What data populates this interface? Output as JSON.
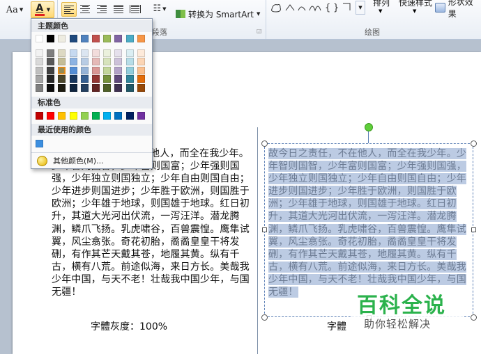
{
  "ribbon": {
    "font_size_label": "Aa",
    "font_color_letter": "A",
    "font_color_accent": "#e01f1f",
    "smartart_label": "转换为 SmartArt",
    "paragraph_group_label": "段落",
    "drawing_group_label": "绘图",
    "arrange_label": "排列",
    "quick_styles_label": "快速样式",
    "shape_effects_label": "形状效果"
  },
  "color_popup": {
    "theme_header": "主题颜色",
    "theme_columns": [
      [
        "#ffffff",
        "#f2f2f2",
        "#d9d9d9",
        "#bfbfbf",
        "#a6a6a6",
        "#7f7f7f"
      ],
      [
        "#000000",
        "#7f7f7f",
        "#595959",
        "#404040",
        "#262626",
        "#0d0d0d"
      ],
      [
        "#eeece1",
        "#ddd9c3",
        "#c4bd97",
        "#948a54",
        "#4a452a",
        "#1d1b10"
      ],
      [
        "#1f497d",
        "#c6d9f0",
        "#8db3e2",
        "#548dd4",
        "#17365d",
        "#0f243e"
      ],
      [
        "#4f81bd",
        "#dbe5f1",
        "#b8cce4",
        "#95b3d7",
        "#366092",
        "#244061"
      ],
      [
        "#c0504d",
        "#f2dcdb",
        "#e5b9b7",
        "#d99694",
        "#953734",
        "#632423"
      ],
      [
        "#9bbb59",
        "#ebf1dd",
        "#d7e3bc",
        "#c3d69b",
        "#76923c",
        "#4f6128"
      ],
      [
        "#8064a2",
        "#e5e0ec",
        "#ccc1d9",
        "#b2a2c7",
        "#5f497a",
        "#3f3151"
      ],
      [
        "#4bacc6",
        "#dbeef3",
        "#b7dde8",
        "#92cddc",
        "#31859b",
        "#205867"
      ],
      [
        "#f79646",
        "#fdeada",
        "#fbd5b5",
        "#fac08f",
        "#e36c09",
        "#974806"
      ]
    ],
    "standard_header": "标准色",
    "standard_colors": [
      "#c00000",
      "#ff0000",
      "#ffc000",
      "#ffff00",
      "#92d050",
      "#00b050",
      "#00b0f0",
      "#0070c0",
      "#002060",
      "#7030a0"
    ],
    "recent_header": "最近使用的颜色",
    "recent_colors": [
      "#3c8fe0"
    ],
    "more_colors_label": "其他颜色(M)..."
  },
  "document": {
    "body_text": "故今日之责任，不在他人，而全在我少年。少年智则国智，少年富则国富；少年强则国强，少年独立则国独立；少年自由则国自由；少年进步则国进步；少年胜于欧洲，则国胜于欧洲；少年雄于地球，则国雄于地球。红日初升，其道大光河出伏流，一泻汪洋。潜龙腾渊，鳞爪飞扬。乳虎啸谷，百兽震惶。鹰隼试翼，风尘翕张。奇花初胎，矞矞皇皇干将发硎，有作其芒天戴其苍，地履其黄。纵有千古，横有八荒。前途似海，来日方长。美哉我少年中国，与天不老！壮哉我中国少年，与国无疆！",
    "left_text_visible": "他人，而全在我少年。少年智则国智，少年富则国富；少年强则国强，少年独立则国独立；少年自由则国自由；少年进步则国进步；少年胜于欧洲，则国胜于欧洲；少年雄于地球，则国雄于地球。红日初升，其道大光河出伏流，一泻汪洋。潜龙腾渊，鳞爪飞扬。乳虎啸谷，百兽震惶。鹰隼试翼，风尘翕张。奇花初胎，矞矞皇皇干将发硎，有作其芒天戴其苍，地履其黄。纵有千古，横有八荒。前途似海，来日方长。美哉我少年中国，与天不老！壮哉我中国少年，与国无疆！",
    "caption_left": "字體灰度：100%",
    "caption_right": "字體"
  },
  "watermark": {
    "title": "百科全说",
    "subtitle": "助你轻松解决"
  }
}
